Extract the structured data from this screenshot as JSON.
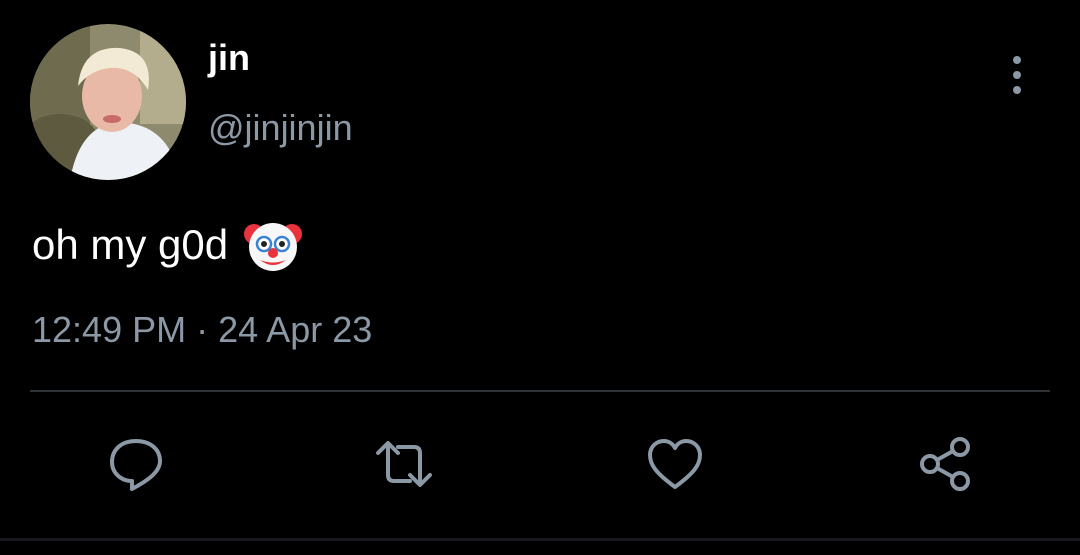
{
  "tweet": {
    "display_name": "jin",
    "handle": "@jinjinjin",
    "text": "oh my g0d",
    "emoji": "clown-face",
    "time": "12:49 PM",
    "separator": "·",
    "date": "24 Apr 23"
  },
  "actions": {
    "icons": [
      "reply-icon",
      "retweet-icon",
      "like-icon",
      "share-icon"
    ]
  },
  "menu": {
    "icon": "more-vertical-icon"
  },
  "colors": {
    "background": "#000000",
    "primary_text": "#ffffff",
    "secondary_text": "#8b98a5",
    "divider": "#2f3336"
  }
}
